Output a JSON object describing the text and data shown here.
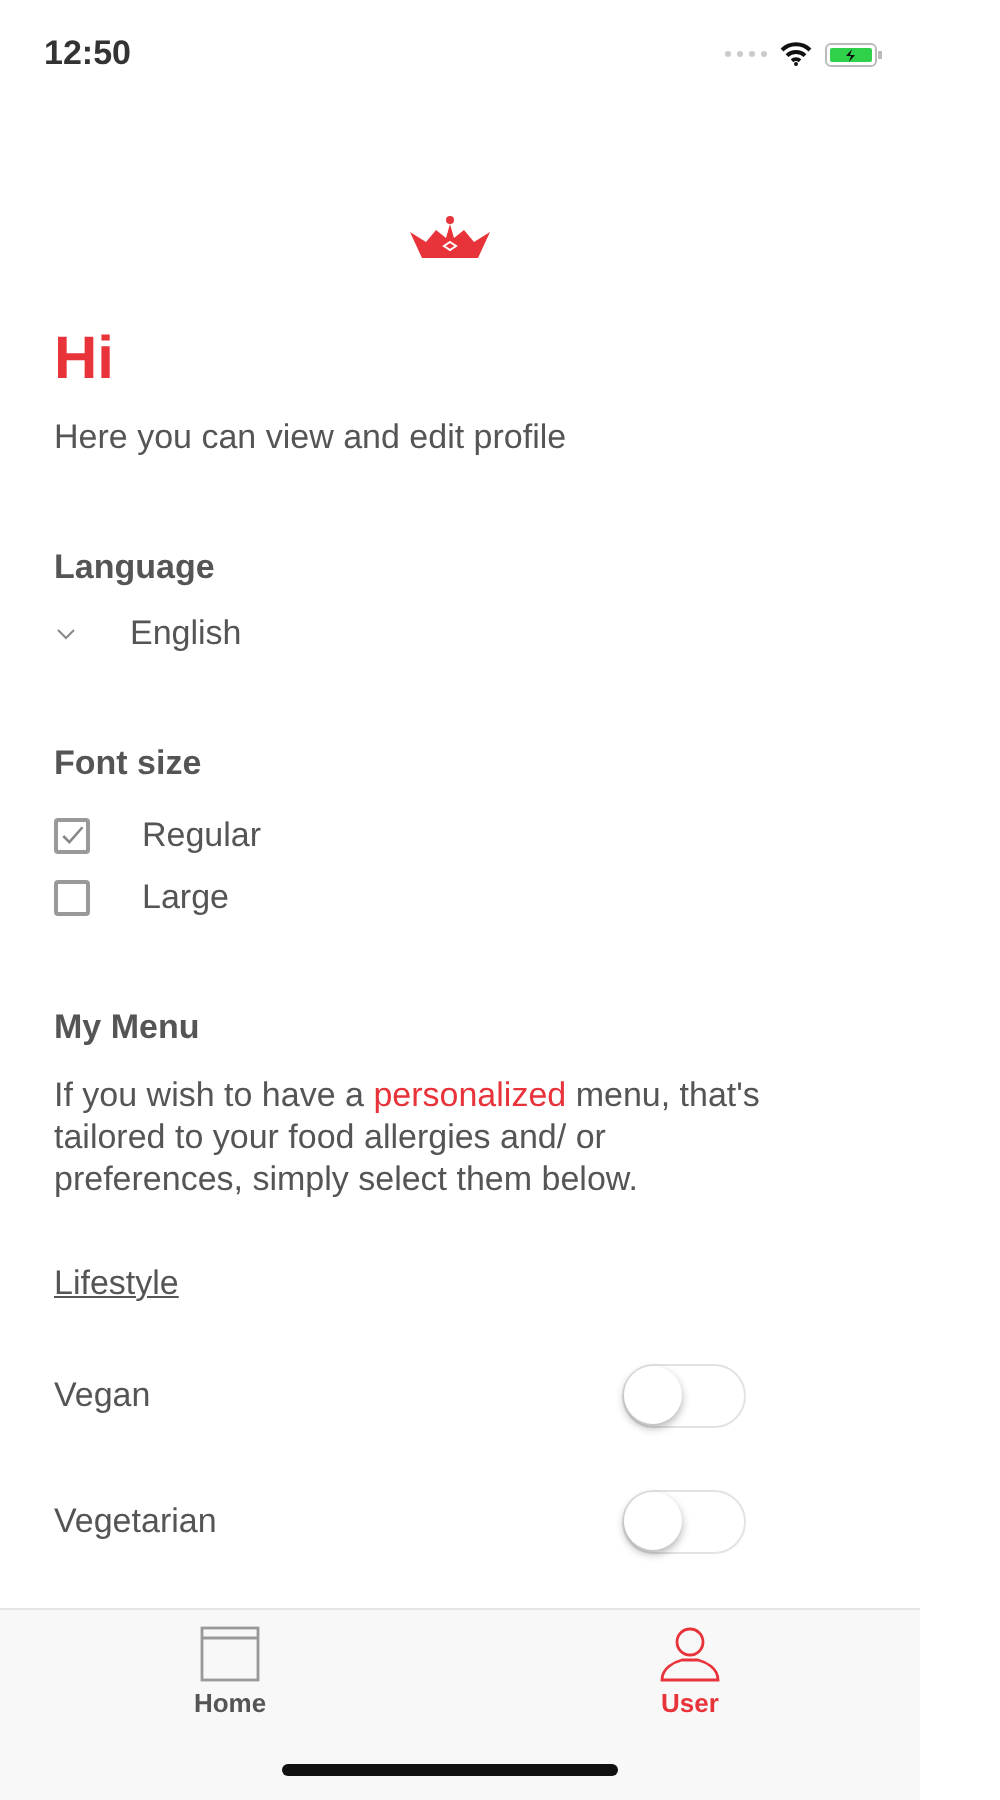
{
  "status_bar": {
    "time": "12:50"
  },
  "greeting": "Hi",
  "subtitle": "Here you can view and edit profile",
  "language": {
    "label": "Language",
    "value": "English"
  },
  "font_size": {
    "label": "Font size",
    "options": [
      {
        "label": "Regular",
        "checked": true
      },
      {
        "label": "Large",
        "checked": false
      }
    ]
  },
  "my_menu": {
    "title": "My Menu",
    "description": [
      {
        "text": "If you wish to have a ",
        "highlight": false
      },
      {
        "text": "personalized",
        "highlight": true
      },
      {
        "text": " menu, that's tailored to your food allergies and/ or preferences, simply select them below.",
        "highlight": false
      }
    ]
  },
  "lifestyle": {
    "title": "Lifestyle",
    "items": [
      {
        "label": "Vegan",
        "on": false
      },
      {
        "label": "Vegetarian",
        "on": false
      }
    ]
  },
  "tab_bar": [
    {
      "label": "Home",
      "kind": "home",
      "selected": false
    },
    {
      "label": "User",
      "kind": "user",
      "selected": true
    }
  ]
}
